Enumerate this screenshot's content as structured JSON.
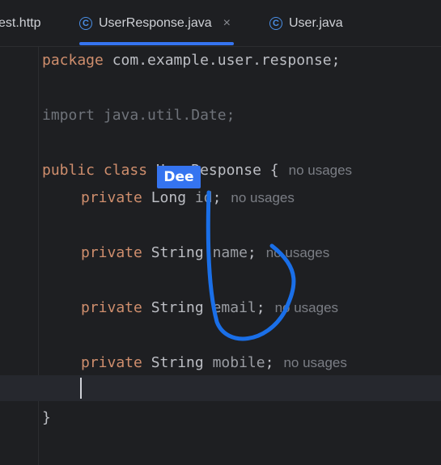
{
  "tabs": [
    {
      "label": "est.http",
      "icon": null,
      "active": false
    },
    {
      "label": "UserResponse.java",
      "icon": "java-class-icon",
      "active": true,
      "close": "×"
    },
    {
      "label": "User.java",
      "icon": "java-class-icon",
      "active": false
    }
  ],
  "code": {
    "line1": {
      "kw": "package",
      "rest": " com.example.user.response;"
    },
    "line2": {
      "text": "import java.util.Date;"
    },
    "line3": {
      "kw": "public class",
      "rest": " UserResponse {",
      "hint": "no usages"
    },
    "line4": {
      "kw": "private",
      "type": " Long ",
      "field": "id",
      "semi": ";",
      "hint": "no usages"
    },
    "line5": {
      "kw": "private",
      "type": " String ",
      "field": "name",
      "semi": ";",
      "hint": "no usages"
    },
    "line6": {
      "kw": "private",
      "type": " String ",
      "field": "email",
      "semi": ";",
      "hint": "no usages"
    },
    "line7": {
      "kw": "private",
      "type": " String ",
      "field": "mobile",
      "semi": ";",
      "hint": "no usages"
    },
    "line9": {
      "text": "}"
    }
  },
  "tooltip": {
    "text": "Dee"
  },
  "colors": {
    "accent": "#3574f0",
    "keyword": "#cf8e6d",
    "stroke": "#1a6fe8"
  }
}
